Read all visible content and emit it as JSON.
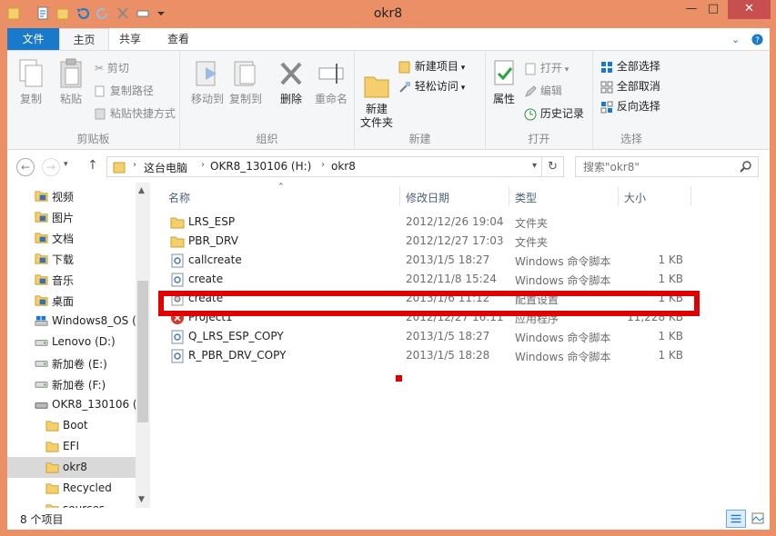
{
  "window": {
    "title": "okr8",
    "min_glyph": "—",
    "max_glyph": "□",
    "close_glyph": "✕"
  },
  "colors": {
    "accent": "#1979ca",
    "frame": "#eb9066",
    "highlight": "#e10000"
  },
  "tabs": {
    "file": "文件",
    "home": "主页",
    "share": "共享",
    "view": "查看"
  },
  "ribbon": {
    "clipboard": {
      "label": "剪贴板",
      "copy": "复制",
      "paste": "粘贴",
      "cut": "剪切",
      "copy_path": "复制路径",
      "paste_shortcut": "粘贴快捷方式"
    },
    "organize": {
      "label": "组织",
      "move_to": "移动到",
      "copy_to": "复制到",
      "delete": "删除",
      "rename": "重命名"
    },
    "new": {
      "label": "新建",
      "new_folder": "新建\n文件夹",
      "new_item": "新建项目",
      "easy_access": "轻松访问"
    },
    "open": {
      "label": "打开",
      "properties": "属性",
      "open": "打开",
      "edit": "编辑",
      "history": "历史记录"
    },
    "select": {
      "label": "选择",
      "select_all": "全部选择",
      "select_none": "全部取消",
      "invert": "反向选择"
    }
  },
  "address": {
    "crumbs": [
      "这台电脑",
      "OKR8_130106 (H:)",
      "okr8"
    ],
    "search_placeholder": "搜索\"okr8\""
  },
  "nav": {
    "items": [
      {
        "label": "视频",
        "icon": "video-folder-icon"
      },
      {
        "label": "图片",
        "icon": "pictures-folder-icon"
      },
      {
        "label": "文档",
        "icon": "documents-folder-icon"
      },
      {
        "label": "下载",
        "icon": "downloads-folder-icon"
      },
      {
        "label": "音乐",
        "icon": "music-folder-icon"
      },
      {
        "label": "桌面",
        "icon": "desktop-folder-icon"
      },
      {
        "label": "Windows8_OS (",
        "icon": "windows-drive-icon"
      },
      {
        "label": "Lenovo (D:)",
        "icon": "drive-icon"
      },
      {
        "label": "新加卷 (E:)",
        "icon": "drive-icon"
      },
      {
        "label": "新加卷 (F:)",
        "icon": "drive-icon"
      },
      {
        "label": "OKR8_130106 (",
        "icon": "usb-drive-icon"
      },
      {
        "label": "Boot",
        "icon": "folder-icon"
      },
      {
        "label": "EFI",
        "icon": "folder-icon"
      },
      {
        "label": "okr8",
        "icon": "folder-icon"
      },
      {
        "label": "Recycled",
        "icon": "folder-icon"
      },
      {
        "label": "sources",
        "icon": "folder-icon"
      }
    ]
  },
  "columns": {
    "name": "名称",
    "date": "修改日期",
    "type": "类型",
    "size": "大小"
  },
  "files": [
    {
      "name": "LRS_ESP",
      "date": "2012/12/26 19:04",
      "type": "文件夹",
      "size": "",
      "icon": "folder-icon"
    },
    {
      "name": "PBR_DRV",
      "date": "2012/12/27 17:03",
      "type": "文件夹",
      "size": "",
      "icon": "folder-icon"
    },
    {
      "name": "callcreate",
      "date": "2013/1/5 18:27",
      "type": "Windows 命令脚本",
      "size": "1 KB",
      "icon": "script-icon"
    },
    {
      "name": "create",
      "date": "2012/11/8 15:24",
      "type": "Windows 命令脚本",
      "size": "1 KB",
      "icon": "script-icon"
    },
    {
      "name": "create",
      "date": "2013/1/6 11:12",
      "type": "配置设置",
      "size": "1 KB",
      "icon": "config-icon"
    },
    {
      "name": "Project1",
      "date": "2012/12/27 16:11",
      "type": "应用程序",
      "size": "11,228 KB",
      "icon": "app-icon"
    },
    {
      "name": "Q_LRS_ESP_COPY",
      "date": "2013/1/5 18:27",
      "type": "Windows 命令脚本",
      "size": "1 KB",
      "icon": "script-icon"
    },
    {
      "name": "R_PBR_DRV_COPY",
      "date": "2013/1/5 18:28",
      "type": "Windows 命令脚本",
      "size": "1 KB",
      "icon": "script-icon"
    }
  ],
  "status": {
    "count": "8 个项目"
  }
}
